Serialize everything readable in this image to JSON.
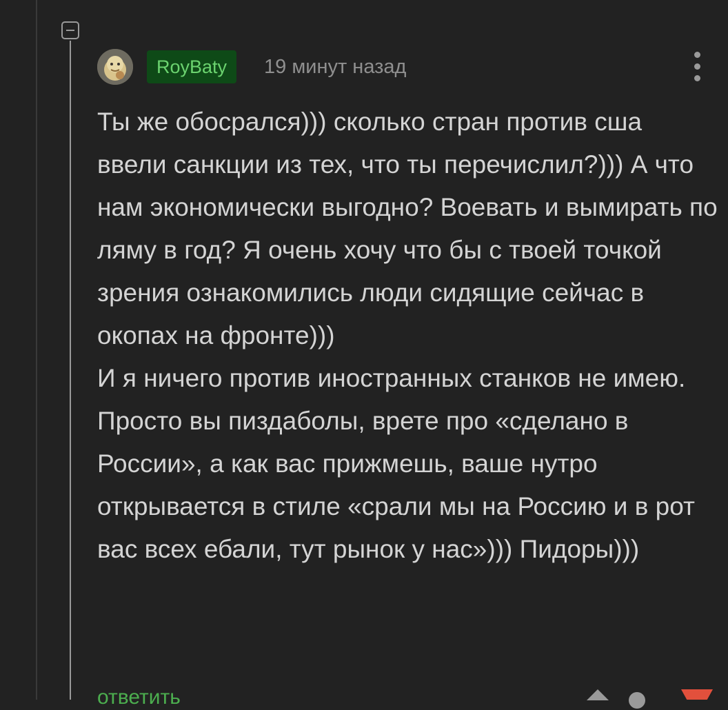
{
  "comment": {
    "author": "RoyBaty",
    "time": "19 минут назад",
    "paragraphs": [
      "Ты же обосрался))) сколько стран против сша ввели санкции из тех, что ты перечислил?))) А что нам экономически выгодно? Воевать и вымирать по ляму в год? Я очень хочу что бы с твоей точкой зрения ознакомились люди сидящие сейчас в окопах на фронте)))",
      "И я ничего против иностранных станков не имею. Просто вы пиздаболы, врете про «сделано в России», а как вас прижмешь, ваше нутро открывается в стиле «срали мы на Россию и в рот вас всех ебали, тут рынок у нас»))) Пидоры)))"
    ],
    "reply_label": "ответить"
  },
  "icons": {
    "collapse": "minus-square-icon",
    "more": "vertical-dots-icon",
    "vote_up": "triangle-up-icon",
    "rating": "dot-icon",
    "vote_down": "triangle-down-icon"
  },
  "colors": {
    "background": "#222222",
    "username_bg": "#0e4a17",
    "username_text": "#6bd36f",
    "reply": "#4cae4f",
    "vote_down": "#e2503c",
    "text": "#d4d4d4",
    "muted": "#8f8f8f"
  }
}
